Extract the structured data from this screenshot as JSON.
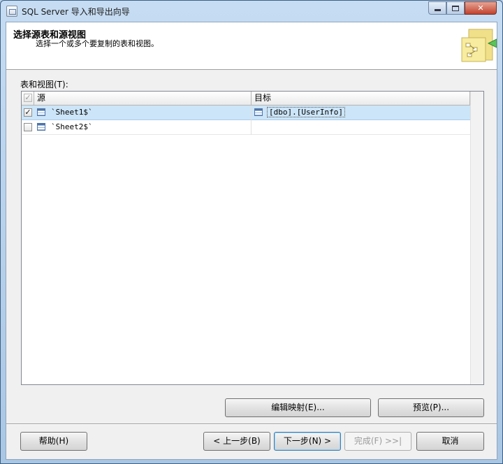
{
  "window": {
    "title": "SQL Server 导入和导出向导",
    "minimize_glyph": "—",
    "close_glyph": "✕"
  },
  "header": {
    "title": "选择源表和源视图",
    "subtitle": "选择一个或多个要复制的表和视图。"
  },
  "tables_label": "表和视图(T):",
  "grid": {
    "columns": {
      "source": "源",
      "target": "目标"
    },
    "header_checked": true,
    "rows": [
      {
        "checked": true,
        "source": "`Sheet1$`",
        "target": "[dbo].[UserInfo]"
      },
      {
        "checked": false,
        "source": "`Sheet2$`",
        "target": ""
      }
    ]
  },
  "buttons": {
    "edit_mappings": "编辑映射(E)...",
    "preview": "预览(P)...",
    "help": "帮助(H)",
    "back": "< 上一步(B)",
    "next": "下一步(N) >",
    "finish": "完成(F) >>|",
    "cancel": "取消"
  },
  "colors": {
    "selection": "#cce5f8",
    "title_bar": "#bcd3ea",
    "header_art": "#f1e08a"
  },
  "icons": [
    "app-icon",
    "table-icon",
    "wizard-header-icon",
    "checkmark-icon"
  ]
}
